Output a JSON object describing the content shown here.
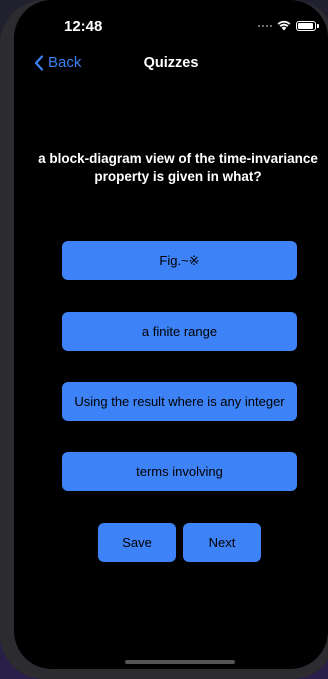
{
  "status_bar": {
    "time": "12:48"
  },
  "nav": {
    "back_label": "Back",
    "title": "Quizzes"
  },
  "question": "a block-diagram view of the time-invariance property is given in what?",
  "answers": [
    "Fig.~※",
    "a finite range",
    "Using the result where is any integer",
    "terms involving"
  ],
  "actions": {
    "save_label": "Save",
    "next_label": "Next"
  },
  "colors": {
    "accent": "#3d82f6",
    "link": "#3b82f6",
    "screen_bg": "#000000"
  },
  "icons": {
    "back": "chevron-left-icon",
    "wifi": "wifi-icon",
    "battery": "battery-icon",
    "signal": "signal-icon"
  }
}
